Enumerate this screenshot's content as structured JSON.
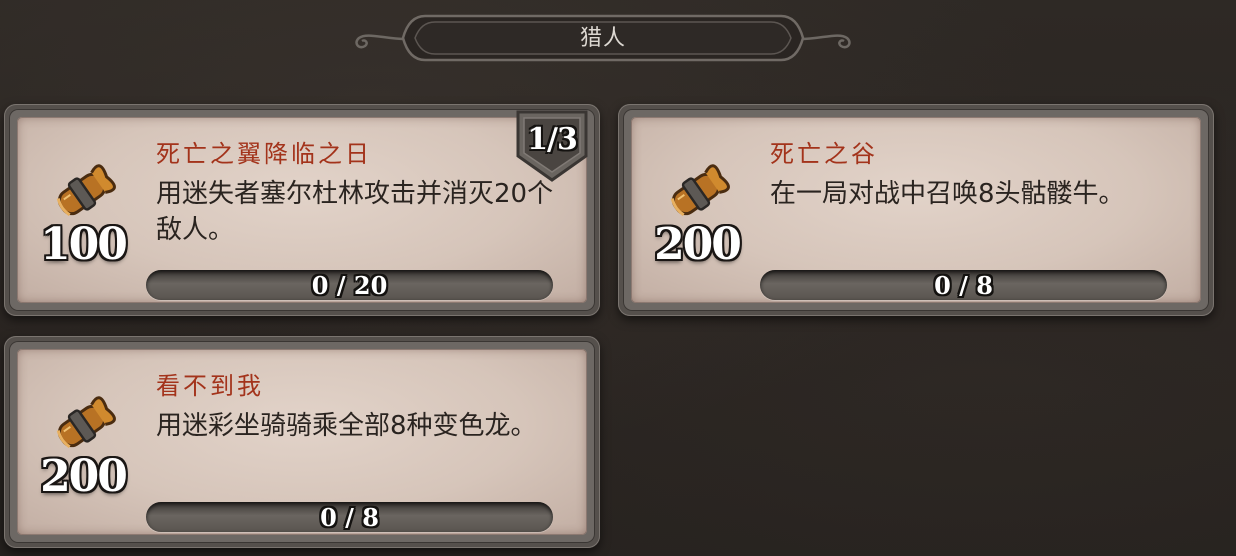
{
  "header": {
    "title": "猎人"
  },
  "quests": [
    {
      "title": "死亡之翼降临之日",
      "description": "用迷失者塞尔杜林攻击并消灭20个敌人。",
      "reward": "100",
      "progress_text": "0 / 20",
      "progress_fraction": 0,
      "chain": "1/3",
      "icon": "reward-scroll-icon"
    },
    {
      "title": "死亡之谷",
      "description": "在一局对战中召唤8头骷髅牛。",
      "reward": "200",
      "progress_text": "0 / 8",
      "progress_fraction": 0,
      "chain": "",
      "icon": "reward-scroll-icon"
    },
    {
      "title": "看不到我",
      "description": "用迷彩坐骑骑乘全部8种变色龙。",
      "reward": "200",
      "progress_text": "0 / 8",
      "progress_fraction": 0,
      "chain": "",
      "icon": "reward-scroll-icon"
    }
  ],
  "colors": {
    "background": "#2b2622",
    "parchment": "#d6c5ba",
    "title_red": "#a3331b",
    "reward_gold": "#c98a2e"
  }
}
